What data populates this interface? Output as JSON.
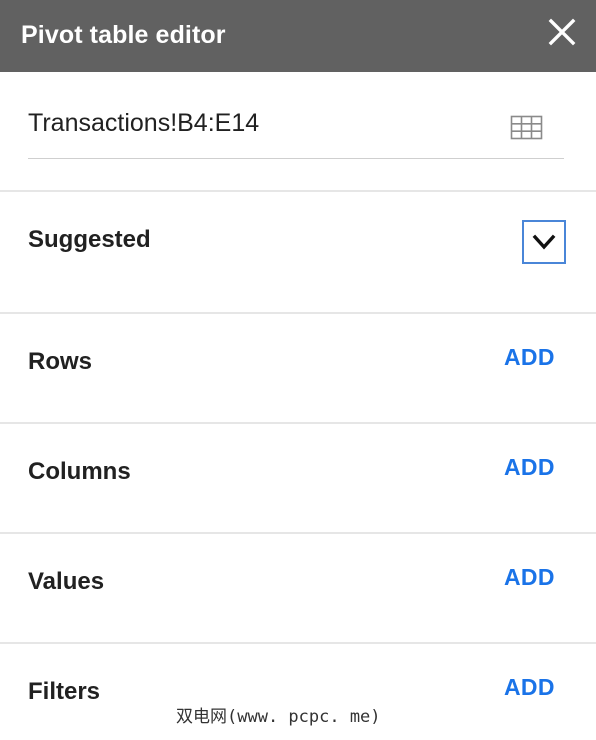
{
  "header": {
    "title": "Pivot table editor",
    "close_icon": "close-icon",
    "background_color": "#616161"
  },
  "data_range": {
    "value": "Transactions!B4:E14",
    "icon": "grid-select-icon"
  },
  "suggested": {
    "label": "Suggested",
    "icon": "chevron-down-icon",
    "border_color": "#4a86d8"
  },
  "sections": {
    "rows": {
      "label": "Rows",
      "action": "ADD"
    },
    "columns": {
      "label": "Columns",
      "action": "ADD"
    },
    "values": {
      "label": "Values",
      "action": "ADD"
    },
    "filters": {
      "label": "Filters",
      "action": "ADD"
    }
  },
  "accent_color": "#1a73e8",
  "watermark": "双电网(www. pcpc. me)"
}
